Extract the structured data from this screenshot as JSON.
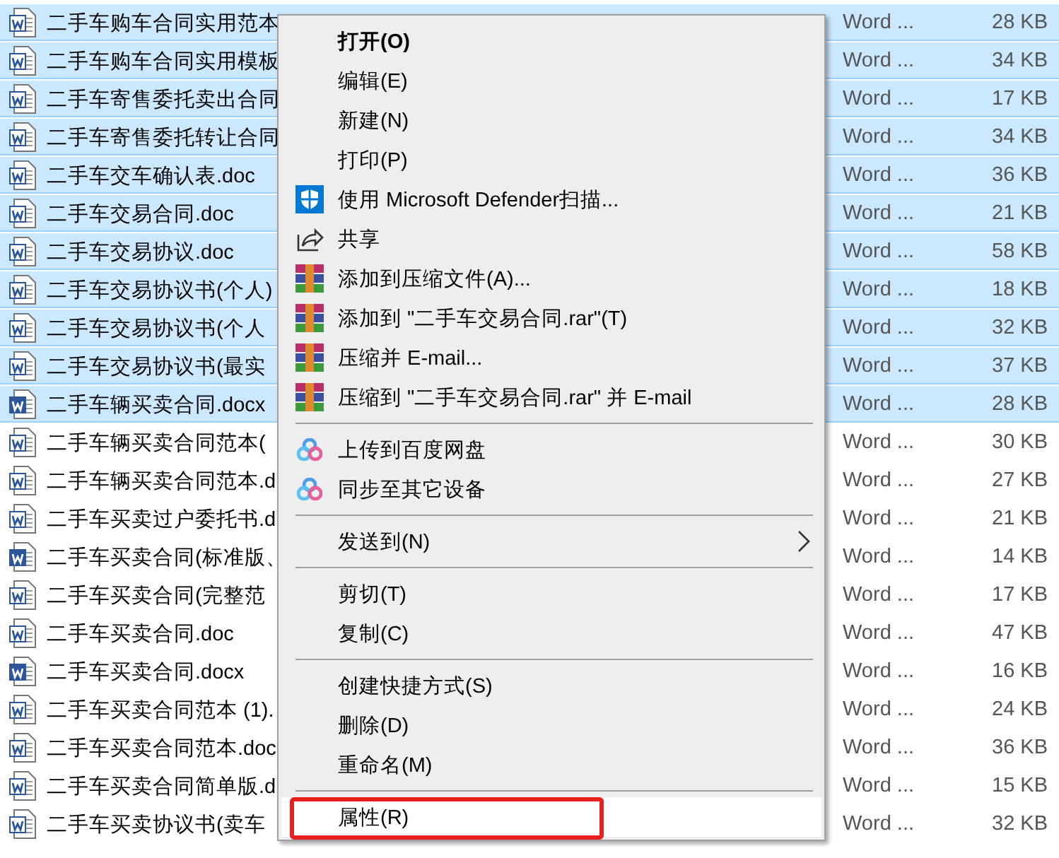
{
  "files": [
    {
      "name": "二手车购车合同实用范本",
      "kind": "doc",
      "type": "Word ...",
      "size": "28 KB",
      "selected": true
    },
    {
      "name": "二手车购车合同实用模板",
      "kind": "doc",
      "type": "Word ...",
      "size": "34 KB",
      "selected": true
    },
    {
      "name": "二手车寄售委托卖出合同",
      "kind": "doc",
      "type": "Word ...",
      "size": "17 KB",
      "selected": true
    },
    {
      "name": "二手车寄售委托转让合同",
      "kind": "doc",
      "type": "Word ...",
      "size": "34 KB",
      "selected": true
    },
    {
      "name": "二手车交车确认表.doc",
      "kind": "doc",
      "type": "Word ...",
      "size": "36 KB",
      "selected": true
    },
    {
      "name": "二手车交易合同.doc",
      "kind": "doc",
      "type": "Word ...",
      "size": "21 KB",
      "selected": true
    },
    {
      "name": "二手车交易协议.doc",
      "kind": "doc",
      "type": "Word ...",
      "size": "58 KB",
      "selected": true
    },
    {
      "name": "二手车交易协议书(个人)",
      "kind": "doc",
      "type": "Word ...",
      "size": "18 KB",
      "selected": true
    },
    {
      "name": "二手车交易协议书(个人",
      "kind": "doc",
      "type": "Word ...",
      "size": "32 KB",
      "selected": true
    },
    {
      "name": "二手车交易协议书(最实",
      "kind": "doc",
      "type": "Word ...",
      "size": "37 KB",
      "selected": true
    },
    {
      "name": "二手车辆买卖合同.docx",
      "kind": "docx",
      "type": "Word ...",
      "size": "28 KB",
      "selected": true
    },
    {
      "name": "二手车辆买卖合同范本(",
      "kind": "doc",
      "type": "Word ...",
      "size": "30 KB",
      "selected": false
    },
    {
      "name": "二手车辆买卖合同范本.d",
      "kind": "doc",
      "type": "Word ...",
      "size": "27 KB",
      "selected": false
    },
    {
      "name": "二手车买卖过户委托书.d",
      "kind": "doc",
      "type": "Word ...",
      "size": "21 KB",
      "selected": false
    },
    {
      "name": "二手车买卖合同(标准版、",
      "kind": "docx",
      "type": "Word ...",
      "size": "14 KB",
      "selected": false
    },
    {
      "name": "二手车买卖合同(完整范",
      "kind": "doc",
      "type": "Word ...",
      "size": "17 KB",
      "selected": false
    },
    {
      "name": "二手车买卖合同.doc",
      "kind": "doc",
      "type": "Word ...",
      "size": "47 KB",
      "selected": false
    },
    {
      "name": "二手车买卖合同.docx",
      "kind": "docx",
      "type": "Word ...",
      "size": "16 KB",
      "selected": false
    },
    {
      "name": "二手车买卖合同范本 (1).",
      "kind": "doc",
      "type": "Word ...",
      "size": "24 KB",
      "selected": false
    },
    {
      "name": "二手车买卖合同范本.doc",
      "kind": "doc",
      "type": "Word ...",
      "size": "36 KB",
      "selected": false
    },
    {
      "name": "二手车买卖合同简单版.d",
      "kind": "doc",
      "type": "Word ...",
      "size": "15 KB",
      "selected": false
    },
    {
      "name": "二手车买卖协议书(卖车",
      "kind": "doc",
      "type": "Word ...",
      "size": "32 KB",
      "selected": false
    }
  ],
  "context_menu": [
    {
      "kind": "plain",
      "label": "打开(O)",
      "bold": true,
      "selected": false
    },
    {
      "kind": "plain",
      "label": "编辑(E)",
      "bold": false,
      "selected": false
    },
    {
      "kind": "plain",
      "label": "新建(N)",
      "bold": false,
      "selected": false
    },
    {
      "kind": "plain",
      "label": "打印(P)",
      "bold": false,
      "selected": false
    },
    {
      "kind": "shield",
      "label": "使用 Microsoft Defender扫描...",
      "bold": false,
      "selected": false
    },
    {
      "kind": "share",
      "label": "共享",
      "bold": false,
      "selected": false
    },
    {
      "kind": "archive",
      "label": "添加到压缩文件(A)...",
      "bold": false,
      "selected": false
    },
    {
      "kind": "archive",
      "label": "添加到 \"二手车交易合同.rar\"(T)",
      "bold": false,
      "selected": false
    },
    {
      "kind": "archive",
      "label": "压缩并 E-mail...",
      "bold": false,
      "selected": false
    },
    {
      "kind": "archive",
      "label": "压缩到 \"二手车交易合同.rar\" 并 E-mail",
      "bold": false,
      "selected": false
    },
    {
      "kind": "separator"
    },
    {
      "kind": "cloud",
      "label": "上传到百度网盘",
      "bold": false,
      "selected": false
    },
    {
      "kind": "cloud",
      "label": "同步至其它设备",
      "bold": false,
      "selected": false
    },
    {
      "kind": "separator"
    },
    {
      "kind": "submenu",
      "label": "发送到(N)",
      "bold": false,
      "selected": false
    },
    {
      "kind": "separator"
    },
    {
      "kind": "plain",
      "label": "剪切(T)",
      "bold": false,
      "selected": false
    },
    {
      "kind": "plain",
      "label": "复制(C)",
      "bold": false,
      "selected": false
    },
    {
      "kind": "separator"
    },
    {
      "kind": "plain",
      "label": "创建快捷方式(S)",
      "bold": false,
      "selected": false
    },
    {
      "kind": "plain",
      "label": "删除(D)",
      "bold": false,
      "selected": false
    },
    {
      "kind": "plain",
      "label": "重命名(M)",
      "bold": false,
      "selected": false
    },
    {
      "kind": "separator"
    },
    {
      "kind": "plain",
      "label": "属性(R)",
      "bold": false,
      "selected": true
    }
  ]
}
